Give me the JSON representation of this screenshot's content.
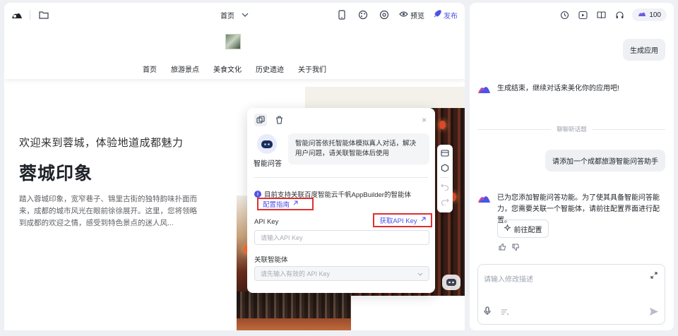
{
  "topbar": {
    "page_selector": "首页",
    "preview_label": "预览",
    "publish_label": "发布",
    "icons": [
      "logo-icon",
      "folder-icon",
      "mobile-icon",
      "palette-icon",
      "settings-icon",
      "eye-icon",
      "rocket-icon"
    ]
  },
  "site": {
    "nav": [
      "首页",
      "旅游景点",
      "美食文化",
      "历史遗迹",
      "关于我们"
    ],
    "hero_subtitle": "欢迎来到蓉城，体验地道成都魅力",
    "hero_title": "蓉城印象",
    "hero_description": "踏入蓉城印象，宽窄巷子、锦里古街的独特韵味扑面而来，成都的城市风光在眼前徐徐展开。这里，您将领略到成都的欢迎之情，感受到特色景点的迷人风..."
  },
  "popover": {
    "agent_name": "智能问答",
    "agent_description": "智能问答依托智能体模拟真人对话，解决用户问题，请关联智能体后使用",
    "info_text": "目前支持关联百度智能云千帆AppBuilder的智能体",
    "guide_link": "配置指南",
    "api_key_label": "API Key",
    "get_api_key_link": "获取API Key",
    "api_key_placeholder": "请输入API Key",
    "agent_select_label": "关联智能体",
    "agent_select_placeholder": "请先输入有效的 API Key",
    "close": "×"
  },
  "chat": {
    "credits": "100",
    "messages": {
      "user_1": "生成应用",
      "bot_1": "生成结束，继续对话来美化你的应用吧!",
      "topic_divider": "聊聊新话题",
      "user_2": "请添加一个成都旅游智能问答助手",
      "bot_2": "已为您添加智能问答功能。为了使其具备智能问答能力，您需要关联一个智能体，请前往配置界面进行配置。",
      "goto_config": "前往配置"
    },
    "composer_placeholder": "请输入修改描述"
  },
  "colors": {
    "accent": "#4d53e8",
    "highlight_border": "#e02f2f",
    "panel_bg": "#eef0f4"
  }
}
